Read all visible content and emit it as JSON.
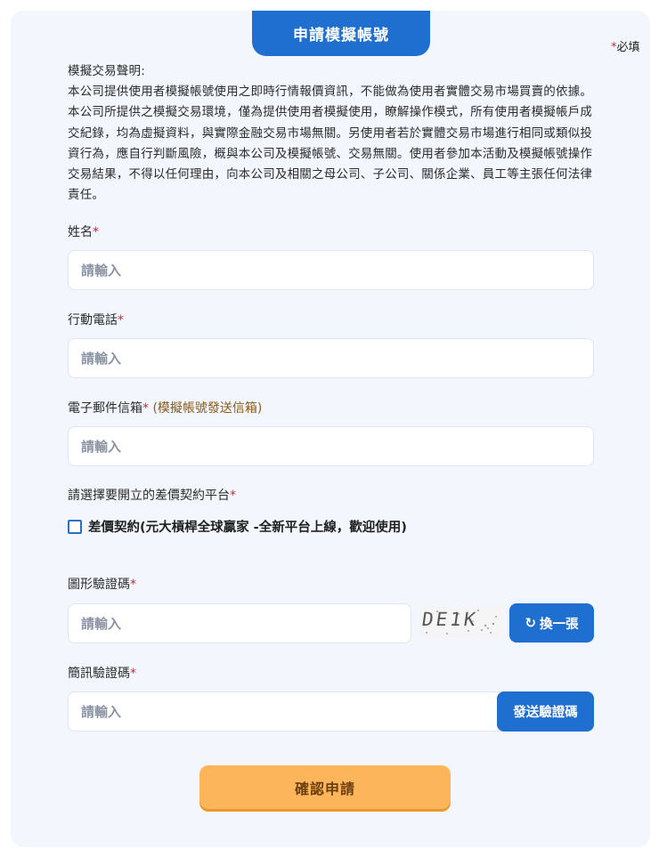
{
  "header": {
    "title": "申請模擬帳號",
    "required_star": "*",
    "required_text": "必填"
  },
  "disclaimer": {
    "heading": "模擬交易聲明:",
    "body": "本公司提供使用者模擬帳號使用之即時行情報價資訊，不能做為使用者實體交易市場買賣的依據。本公司所提供之模擬交易環境，僅為提供使用者模擬使用，瞭解操作模式，所有使用者模擬帳戶成交紀錄，均為虛擬資料，與實際金融交易市場無關。另使用者若於實體交易市場進行相同或類似投資行為，應自行判斷風險，概與本公司及模擬帳號、交易無關。使用者參加本活動及模擬帳號操作交易結果，不得以任何理由，向本公司及相關之母公司、子公司、關係企業、員工等主張任何法律責任。"
  },
  "form": {
    "star": "*",
    "name": {
      "label": "姓名",
      "placeholder": "請輸入",
      "value": ""
    },
    "phone": {
      "label": "行動電話",
      "placeholder": "請輸入",
      "value": ""
    },
    "email": {
      "label": "電子郵件信箱",
      "note": "(模擬帳號發送信箱)",
      "placeholder": "請輸入",
      "value": ""
    },
    "platform": {
      "label": "請選擇要開立的差價契約平台",
      "option_label": "差價契約(元大槓桿全球贏家 -全新平台上線，歡迎使用)",
      "checked": false
    },
    "captcha": {
      "label": "圖形驗證碼",
      "placeholder": "請輸入",
      "value": "",
      "image_text": "DE1K",
      "refresh_icon": "refresh-icon",
      "refresh_glyph": "↻",
      "refresh_label": "換一張"
    },
    "sms": {
      "label": "簡訊驗證碼",
      "placeholder": "請輸入",
      "value": "",
      "send_label": "發送驗證碼"
    },
    "submit_label": "確認申請"
  },
  "colors": {
    "primary": "#1f6fd0",
    "required": "#e0202a",
    "submit": "#fdb55b",
    "background": "#f3f7fd"
  }
}
